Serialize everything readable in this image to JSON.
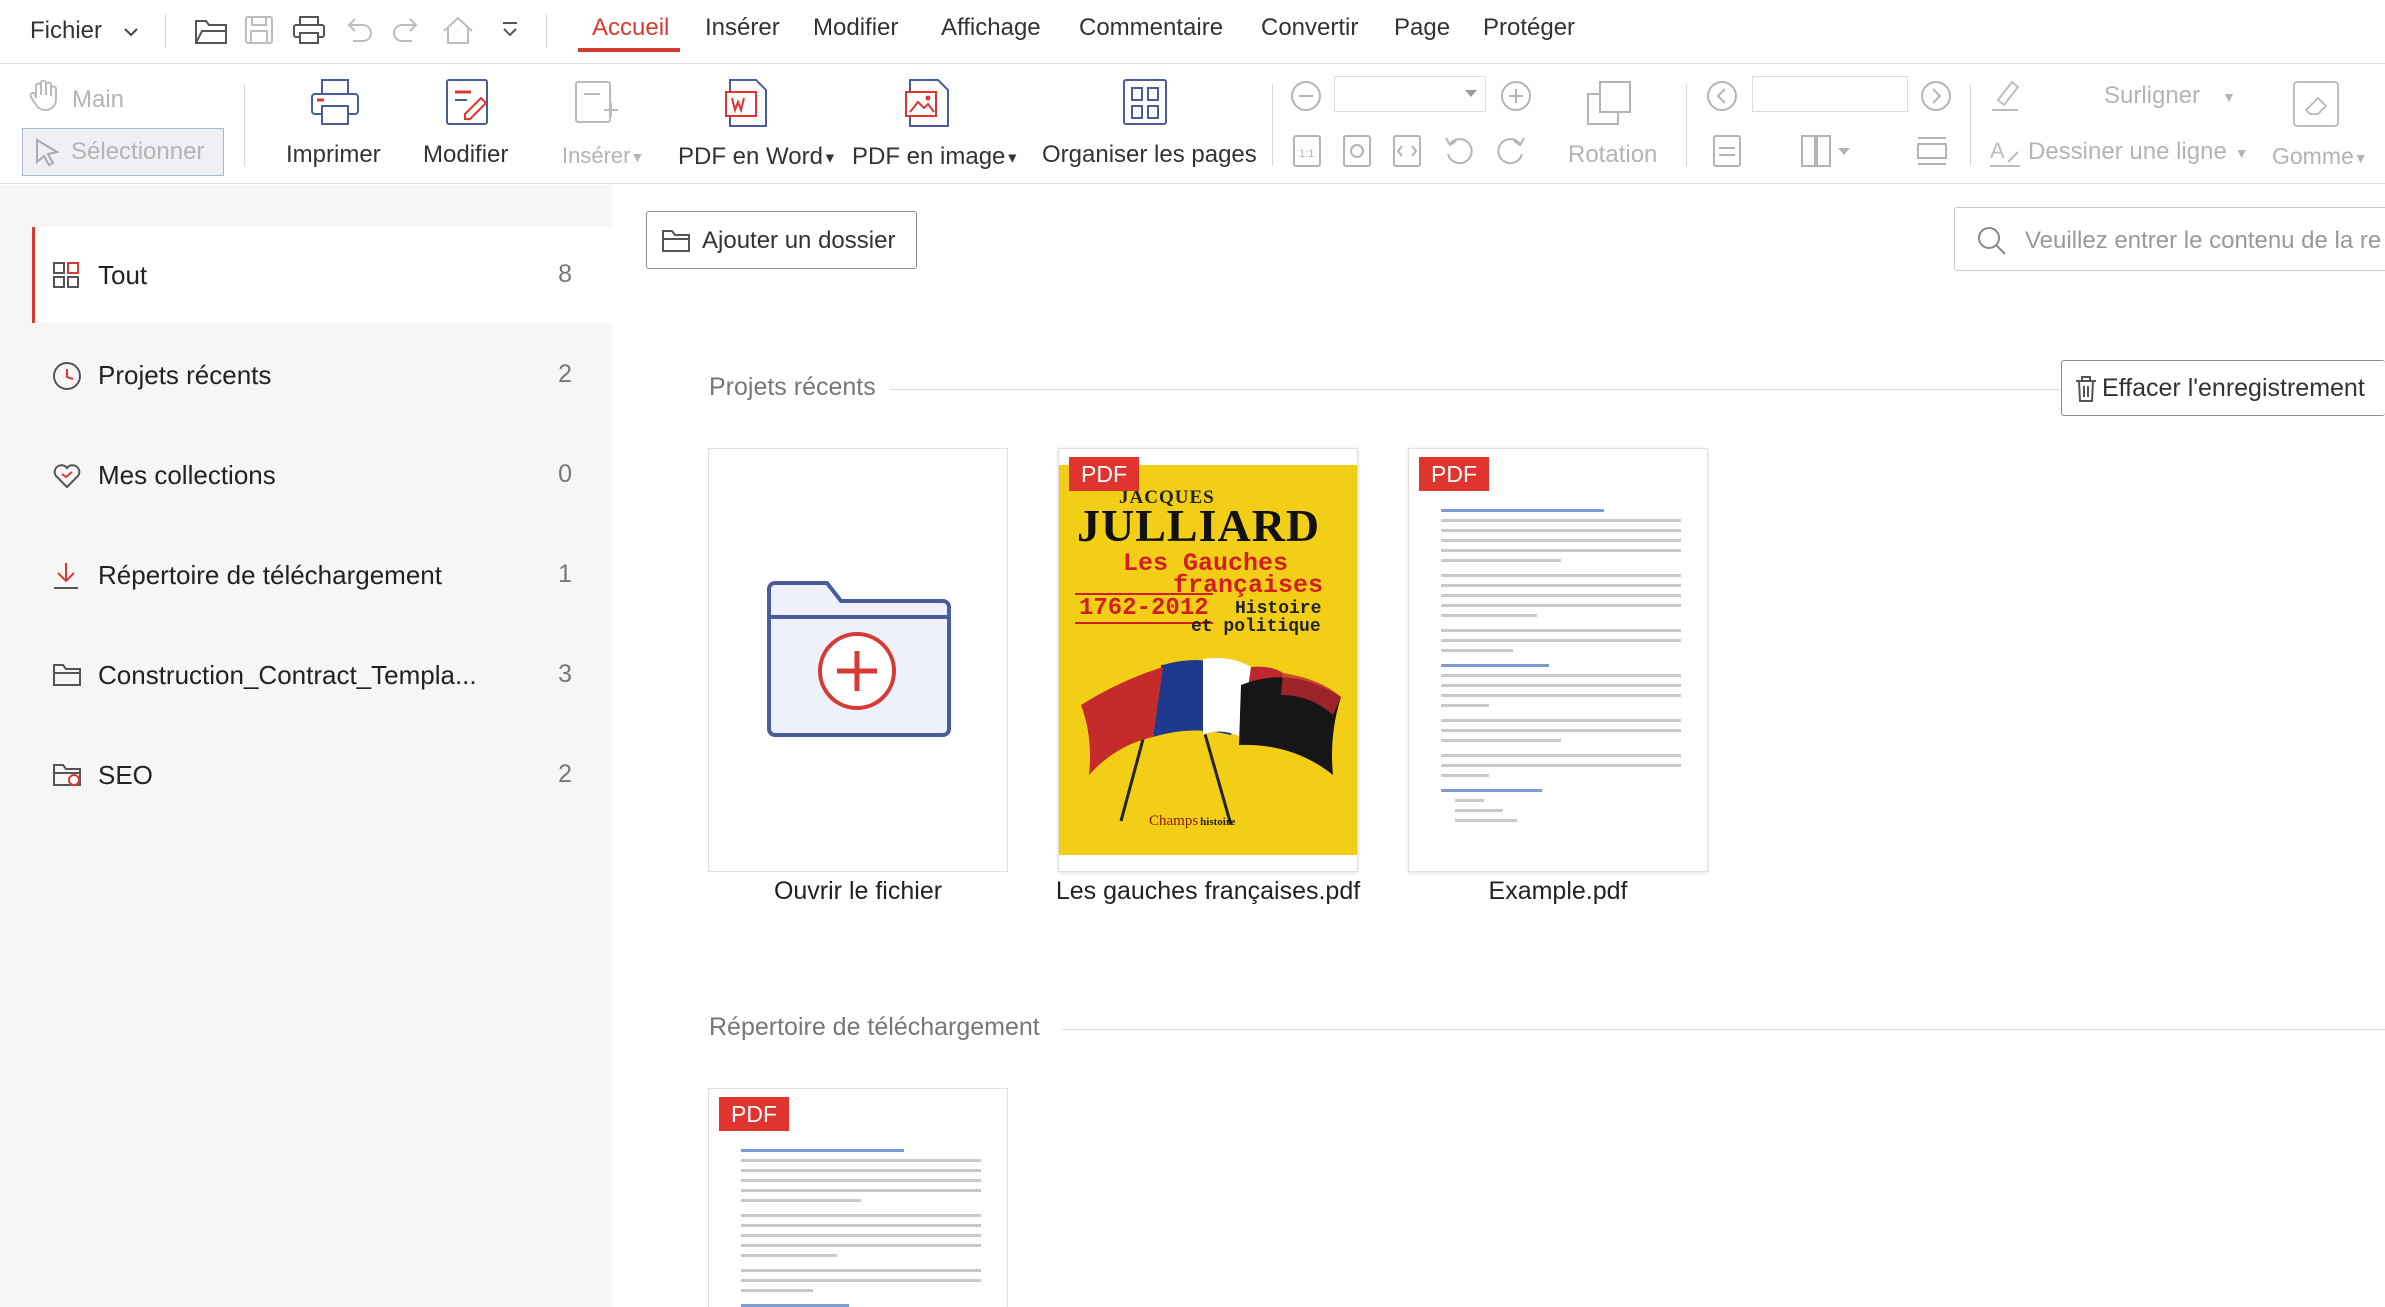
{
  "menubar": {
    "file": "Fichier",
    "tabs": [
      "Accueil",
      "Insérer",
      "Modifier",
      "Affichage",
      "Commentaire",
      "Convertir",
      "Page",
      "Protéger"
    ],
    "active_tab": "Accueil"
  },
  "ribbon": {
    "main": "Main",
    "select": "Sélectionner",
    "print": "Imprimer",
    "edit": "Modifier",
    "insert": "Insérer",
    "pdf_to_word": "PDF en Word",
    "pdf_to_image": "PDF en image",
    "organize": "Organiser les pages",
    "rotation": "Rotation",
    "highlight": "Surligner",
    "draw_line": "Dessiner une ligne",
    "eraser": "Gomme"
  },
  "sidebar": {
    "items": [
      {
        "label": "Tout",
        "count": "8",
        "icon": "grid-icon"
      },
      {
        "label": "Projets récents",
        "count": "2",
        "icon": "clock-icon"
      },
      {
        "label": "Mes collections",
        "count": "0",
        "icon": "heart-icon"
      },
      {
        "label": "Répertoire de téléchargement",
        "count": "1",
        "icon": "download-icon"
      },
      {
        "label": "Construction_Contract_Templa...",
        "count": "3",
        "icon": "folder-icon"
      },
      {
        "label": "SEO",
        "count": "2",
        "icon": "folder-icon"
      }
    ]
  },
  "main": {
    "add_folder": "Ajouter un dossier",
    "search_placeholder": "Veuillez entrer le contenu de la re",
    "recent_title": "Projets récents",
    "clear_history": "Effacer l'enregistrement",
    "download_title": "Répertoire de téléchargement",
    "badge": "PDF",
    "cards": [
      {
        "caption": "Ouvrir le fichier"
      },
      {
        "caption": "Les gauches françaises.pdf"
      },
      {
        "caption": "Example.pdf"
      }
    ],
    "book": {
      "author_first": "JACQUES",
      "author_last": "JULLIARD",
      "title_1": "Les Gauches",
      "title_2": "françaises",
      "years": "1762-2012",
      "subtitle_1": "Histoire",
      "subtitle_2": "et politique",
      "publisher": "Champs",
      "collection": "histoire"
    }
  },
  "colors": {
    "accent": "#d63a35",
    "badge": "#e0342e",
    "book_cover": "#f2cf16"
  }
}
